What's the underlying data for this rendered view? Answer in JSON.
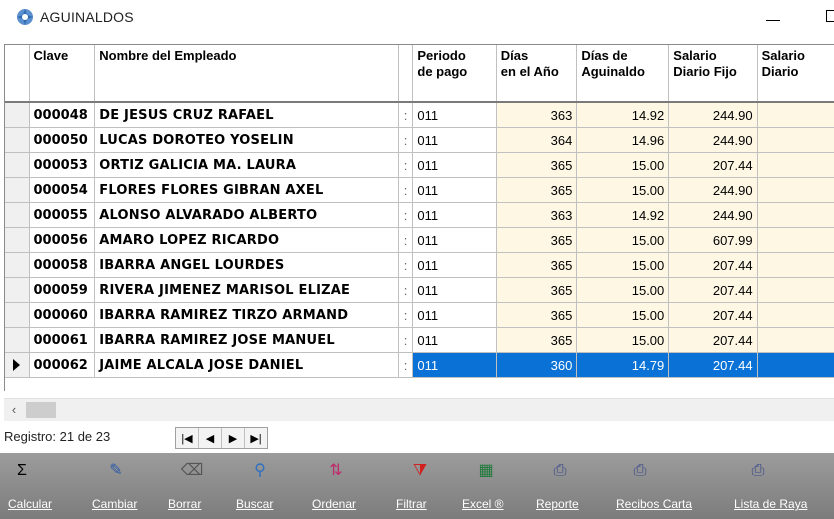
{
  "window": {
    "title": "AGUINALDOS"
  },
  "grid": {
    "headers": {
      "clave": "Clave",
      "nombre": "Nombre del Empleado",
      "periodo_1": "Periodo",
      "periodo_2": "de pago",
      "dias_1": "Días",
      "dias_2": "en el Año",
      "agui_1": "Días de",
      "agui_2": "Aguinaldo",
      "sal_1": "Salario",
      "sal_2": "Diario Fijo",
      "sal2_1": "Salario",
      "sal2_2": "Diario"
    },
    "rows": [
      {
        "clave": "000048",
        "nombre": "DE JESUS CRUZ RAFAEL",
        "periodo": "011",
        "dias": "363",
        "aguinaldo": "14.92",
        "salario": "244.90",
        "sal2": ""
      },
      {
        "clave": "000050",
        "nombre": "LUCAS DOROTEO YOSELIN",
        "periodo": "011",
        "dias": "364",
        "aguinaldo": "14.96",
        "salario": "244.90",
        "sal2": ""
      },
      {
        "clave": "000053",
        "nombre": "ORTIZ GALICIA MA. LAURA",
        "periodo": "011",
        "dias": "365",
        "aguinaldo": "15.00",
        "salario": "207.44",
        "sal2": ""
      },
      {
        "clave": "000054",
        "nombre": "FLORES FLORES GIBRAN AXEL",
        "periodo": "011",
        "dias": "365",
        "aguinaldo": "15.00",
        "salario": "244.90",
        "sal2": ""
      },
      {
        "clave": "000055",
        "nombre": "ALONSO ALVARADO ALBERTO",
        "periodo": "011",
        "dias": "363",
        "aguinaldo": "14.92",
        "salario": "244.90",
        "sal2": ""
      },
      {
        "clave": "000056",
        "nombre": "AMARO LOPEZ RICARDO",
        "periodo": "011",
        "dias": "365",
        "aguinaldo": "15.00",
        "salario": "607.99",
        "sal2": ""
      },
      {
        "clave": "000058",
        "nombre": "IBARRA ANGEL LOURDES",
        "periodo": "011",
        "dias": "365",
        "aguinaldo": "15.00",
        "salario": "207.44",
        "sal2": ""
      },
      {
        "clave": "000059",
        "nombre": "RIVERA JIMENEZ MARISOL ELIZAE",
        "periodo": "011",
        "dias": "365",
        "aguinaldo": "15.00",
        "salario": "207.44",
        "sal2": ""
      },
      {
        "clave": "000060",
        "nombre": "IBARRA RAMIREZ TIRZO ARMAND",
        "periodo": "011",
        "dias": "365",
        "aguinaldo": "15.00",
        "salario": "207.44",
        "sal2": ""
      },
      {
        "clave": "000061",
        "nombre": "IBARRA RAMIREZ JOSE MANUEL",
        "periodo": "011",
        "dias": "365",
        "aguinaldo": "15.00",
        "salario": "207.44",
        "sal2": ""
      },
      {
        "clave": "000062",
        "nombre": "JAIME ALCALA JOSE DANIEL",
        "periodo": "011",
        "dias": "360",
        "aguinaldo": "14.79",
        "salario": "207.44",
        "sal2": ""
      }
    ]
  },
  "navigator": {
    "registro": "Registro: 21 de 23"
  },
  "toolbar": [
    {
      "label": "Calcular",
      "icon": "sigma-icon",
      "glyph": "Σ"
    },
    {
      "label": "Cambiar",
      "icon": "edit-icon",
      "glyph": "✎"
    },
    {
      "label": "Borrar",
      "icon": "eraser-icon",
      "glyph": "⌫"
    },
    {
      "label": "Buscar",
      "icon": "search-icon",
      "glyph": "⚲"
    },
    {
      "label": "Ordenar",
      "icon": "sort-icon",
      "glyph": "⇅"
    },
    {
      "label": "Filtrar",
      "icon": "filter-icon",
      "glyph": "⧩"
    },
    {
      "label": "Excel ®",
      "icon": "excel-icon",
      "glyph": "▦"
    },
    {
      "label": "Reporte",
      "icon": "report-icon",
      "glyph": "⎙"
    },
    {
      "label": "Recibos Carta",
      "icon": "receipt-icon",
      "glyph": "⎙"
    },
    {
      "label": "Lista de Raya",
      "icon": "list-icon",
      "glyph": "⎙"
    }
  ]
}
